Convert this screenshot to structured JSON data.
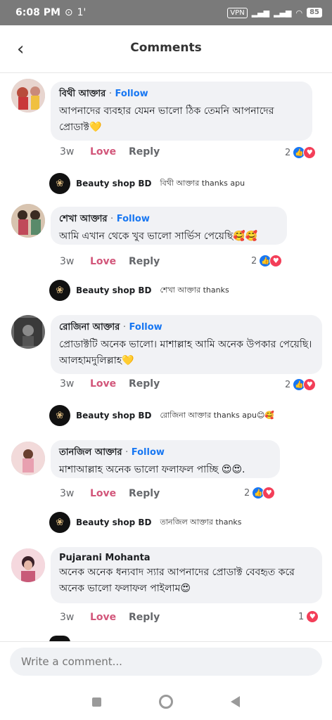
{
  "status_bar": {
    "time": "6:08 PM",
    "carrier_extra": "1'",
    "vpn": "VPN",
    "battery": "85"
  },
  "header": {
    "title": "Comments",
    "back_icon": "chevron-left-icon"
  },
  "comments": [
    {
      "name": "বিথী আক্তার",
      "follow": "Follow",
      "text": "আপনাদের ব্যবহার যেমন ভালো ঠিক তেমনি আপনাদের প্রোডাক্ট💛",
      "age": "3w",
      "love": "Love",
      "reply": "Reply",
      "count": "2",
      "reply_name": "Beauty shop BD",
      "reply_text": "বিথী আক্তার thanks apu",
      "avatar_color": "#c98a7a"
    },
    {
      "name": "শেখা আক্তার",
      "follow": "Follow",
      "text": "আমি এখান থেকে খুব ভালো সার্ভিস পেয়েছি🥰🥰",
      "age": "3w",
      "love": "Love",
      "reply": "Reply",
      "count": "2",
      "reply_name": "Beauty shop BD",
      "reply_text": "শেখা আক্তার thanks",
      "avatar_color": "#9a6b4b"
    },
    {
      "name": "রোজিনা আক্তার",
      "follow": "Follow",
      "text": "প্রোডাক্টটি অনেক ভালো। মাশাল্লাহ আমি অনেক উপকার পেয়েছি। আলহামদুলিল্লাহ💛",
      "age": "3w",
      "love": "Love",
      "reply": "Reply",
      "count": "2",
      "reply_name": "Beauty shop BD",
      "reply_text": "রোজিনা আক্তার thanks apu😊🥰",
      "avatar_color": "#4a4a4a"
    },
    {
      "name": "তানজিল আক্তার",
      "follow": "Follow",
      "text": "মাশাআল্লাহ অনেক ভালো ফলাফল পাচ্ছি 😍😍.",
      "age": "3w",
      "love": "Love",
      "reply": "Reply",
      "count": "2",
      "reply_name": "Beauty shop BD",
      "reply_text": "তানজিল আক্তার thanks",
      "avatar_color": "#e7b3b8"
    },
    {
      "name": "Pujarani Mohanta",
      "follow": "",
      "text": "অনেক অনেক ধন্যবাদ স্যার আপনাদের প্রোডাক্ট বেবহৃত করে অনেক ভালো ফলাফল পাইলাম😍",
      "age": "3w",
      "love": "Love",
      "reply": "Reply",
      "count": "1",
      "avatar_color": "#d49aa8"
    }
  ],
  "composer": {
    "placeholder": "Write a comment..."
  },
  "colors": {
    "accent": "#1877f2",
    "love": "#d2567a",
    "status_bar": "#7a7a7a"
  }
}
